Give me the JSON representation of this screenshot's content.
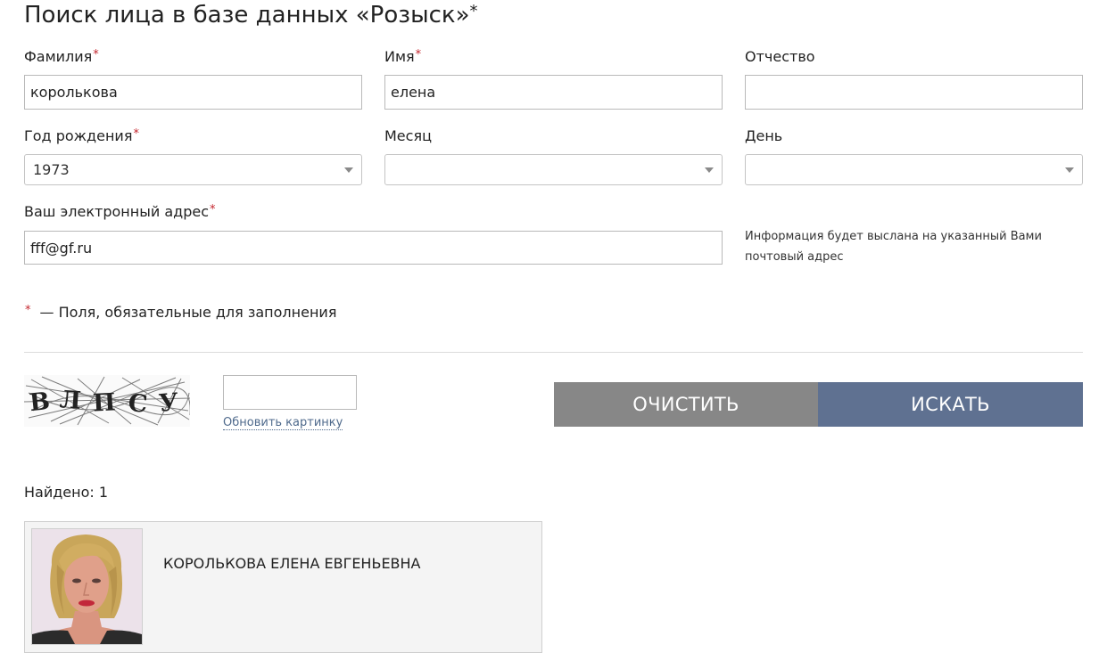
{
  "page": {
    "title": "Поиск лица в базе данных «Розыск»",
    "title_mark": "*"
  },
  "form": {
    "surname": {
      "label": "Фамилия",
      "required_mark": "*",
      "value": "королькова"
    },
    "name": {
      "label": "Имя",
      "required_mark": "*",
      "value": "елена"
    },
    "patronymic": {
      "label": "Отчество",
      "value": ""
    },
    "birth_year": {
      "label": "Год рождения",
      "required_mark": "*",
      "selected": "1973"
    },
    "month": {
      "label": "Месяц",
      "selected": ""
    },
    "day": {
      "label": "День",
      "selected": ""
    },
    "email": {
      "label": "Ваш электронный адрес",
      "required_mark": "*",
      "value": "fff@gf.ru"
    },
    "email_note_line1": "Информация будет выслана на указанный Вами",
    "email_note_line2": "почтовый адрес",
    "required_note": {
      "mark": "*",
      "text": "— Поля, обязательные для заполнения"
    }
  },
  "captcha": {
    "image_text": "ВЛПСУ",
    "input_value": "",
    "refresh_link": "Обновить картинку"
  },
  "buttons": {
    "clear_label": "ОЧИСТИТЬ",
    "search_label": "ИСКАТЬ",
    "clear_color": "#878787",
    "search_color": "#5f7191"
  },
  "results": {
    "found_label": "Найдено: 1",
    "items": [
      {
        "full_name": "КОРОЛЬКОВА ЕЛЕНА ЕВГЕНЬЕВНА"
      }
    ]
  }
}
